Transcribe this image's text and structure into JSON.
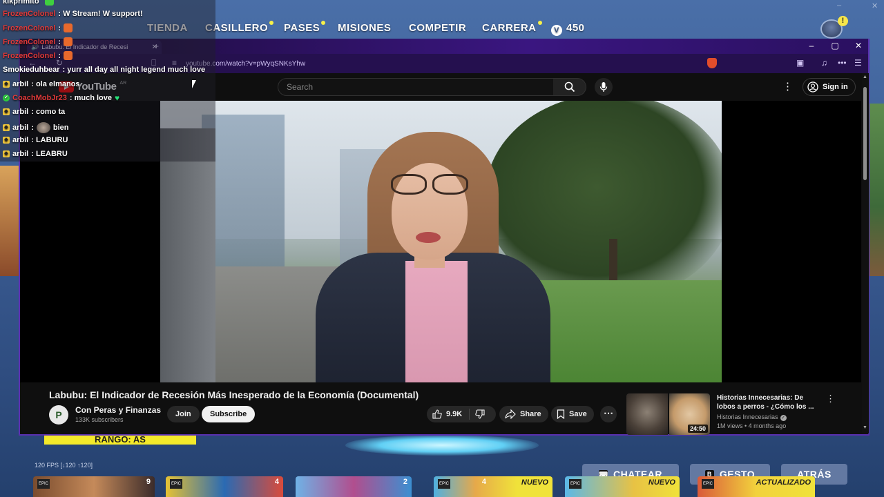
{
  "game": {
    "nav": [
      {
        "label": "TIENDA",
        "dot": false
      },
      {
        "label": "CASILLERO",
        "dot": true
      },
      {
        "label": "PASES",
        "dot": true
      },
      {
        "label": "MISIONES",
        "dot": false
      },
      {
        "label": "COMPETIR",
        "dot": false
      },
      {
        "label": "CARRERA",
        "dot": true
      },
      {
        "label": "450",
        "dot": false
      }
    ],
    "alert_badge": "!",
    "rank_banner": "RANGO: AS",
    "fps": "120 FPS [↓120 ↑120]",
    "buttons": {
      "chat": "CHATEAR",
      "chat_key": "⌨",
      "emote": "GESTO",
      "emote_key": "B",
      "back": "ATRÁS"
    },
    "tiles": [
      {
        "badge": "9",
        "tag": "EPIC"
      },
      {
        "badge": "4",
        "tag": "EPIC"
      },
      {
        "badge": "2",
        "tag": ""
      },
      {
        "badge": "4",
        "label": "NUEVO",
        "tag": "EPIC"
      },
      {
        "label": "NUEVO",
        "tag": "EPIC"
      },
      {
        "label": "ACTUALIZADO",
        "tag": "EPIC"
      }
    ]
  },
  "browser": {
    "tab_title": "Labubu: El Indicador de Recesi",
    "url": "youtube.com/watch?v=pWyqSNKsYhw",
    "window_controls": {
      "minimize": "–",
      "maximize": "▢",
      "close": "✕"
    }
  },
  "youtube": {
    "logo": "YouTube",
    "region": "AR",
    "search_placeholder": "Search",
    "sign_in": "Sign in",
    "video_title": "Labubu: El Indicador de Recesión Más Inesperado de la Economía (Documental)",
    "channel": {
      "name": "Con Peras y Finanzas",
      "subscribers": "133K subscribers",
      "initial": "P"
    },
    "join": "Join",
    "subscribe": "Subscribe",
    "likes": "9.9K",
    "share": "Share",
    "save": "Save",
    "recommended": {
      "title": "Historias Innecesarias: De lobos a perros - ¿Cómo los ...",
      "channel": "Historias Innecesarias",
      "meta": "1M views • 4 months ago",
      "duration": "24:50"
    }
  },
  "chat": [
    {
      "user": "kikprimito",
      "message": "",
      "emote": "green",
      "color": "white",
      "badge": ""
    },
    {
      "user": "FrozenColonel",
      "message": ": W Stream! W support!",
      "color": "red",
      "badge": ""
    },
    {
      "user": "FrozenColonel",
      "message": ":",
      "emote": "orange",
      "color": "red",
      "badge": ""
    },
    {
      "user": "FrozenColonel",
      "message": ":",
      "emote": "orange",
      "color": "red",
      "badge": ""
    },
    {
      "user": "FrozenColonel",
      "message": ":",
      "emote": "orange",
      "color": "red",
      "badge": ""
    },
    {
      "user": "Smokieduhbear",
      "message": ": yurr all day all night legend much love",
      "color": "white",
      "badge": ""
    },
    {
      "user": "arbil",
      "message": ": ola elmanos",
      "color": "white",
      "badge": "sub"
    },
    {
      "user": "CoachMobJr23",
      "message": ": much love",
      "emote": "heart",
      "color": "red",
      "badge": "green"
    },
    {
      "user": "arbil",
      "message": ": como ta",
      "color": "white",
      "badge": "sub"
    },
    {
      "user": "arbil",
      "message": ":",
      "emote": "face",
      "after": "bien",
      "color": "white",
      "badge": "sub"
    },
    {
      "user": "arbil",
      "message": ": LABURU",
      "color": "white",
      "badge": "sub"
    },
    {
      "user": "arbil",
      "message": ": LEABRU",
      "color": "white",
      "badge": "sub"
    }
  ]
}
